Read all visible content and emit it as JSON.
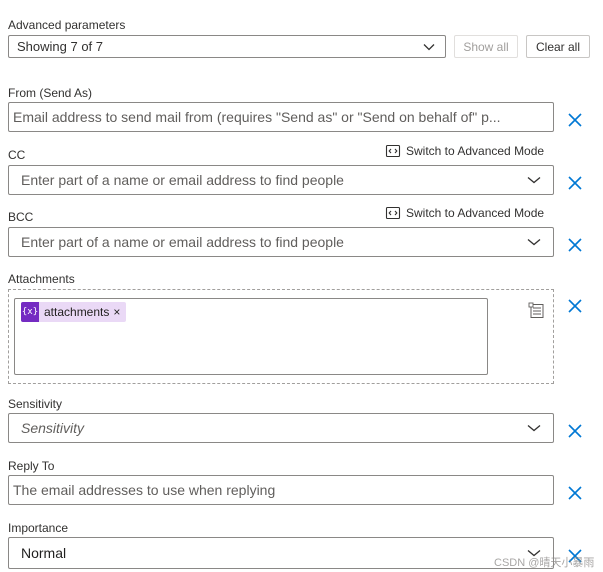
{
  "advanced": {
    "label": "Advanced parameters",
    "selected": "Showing 7 of 7",
    "show_all": "Show all",
    "clear_all": "Clear all"
  },
  "from": {
    "label": "From (Send As)",
    "placeholder": "Email address to send mail from (requires \"Send as\" or \"Send on behalf of\" p..."
  },
  "cc": {
    "label": "CC",
    "switch": "Switch to Advanced Mode",
    "placeholder": "Enter part of a name or email address to find people"
  },
  "bcc": {
    "label": "BCC",
    "switch": "Switch to Advanced Mode",
    "placeholder": "Enter part of a name or email address to find people"
  },
  "attachments": {
    "label": "Attachments",
    "token_icon": "{x}",
    "token_label": "attachments",
    "token_remove": "×"
  },
  "sensitivity": {
    "label": "Sensitivity",
    "placeholder": "Sensitivity"
  },
  "reply_to": {
    "label": "Reply To",
    "placeholder": "The email addresses to use when replying"
  },
  "importance": {
    "label": "Importance",
    "value": "Normal"
  },
  "watermark": "CSDN @晴天小暴雨",
  "colors": {
    "accent_blue": "#0078d4",
    "token_purple": "#742bc2",
    "token_bg": "#ead9f6"
  }
}
